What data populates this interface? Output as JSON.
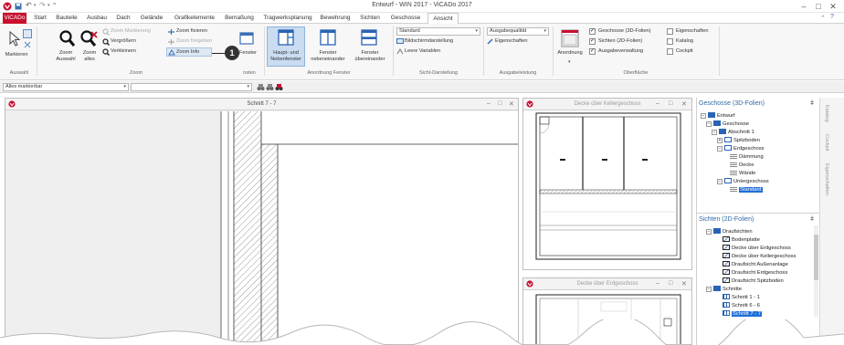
{
  "window": {
    "title": "Entwurf - WIN 2017 - ViCADo 2017"
  },
  "tabs": [
    {
      "label": "ViCADo"
    },
    {
      "label": "Start"
    },
    {
      "label": "Bauteile"
    },
    {
      "label": "Ausbau"
    },
    {
      "label": "Dach"
    },
    {
      "label": "Gelände"
    },
    {
      "label": "Grafikelemente"
    },
    {
      "label": "Bemaßung"
    },
    {
      "label": "Tragwerksplanung"
    },
    {
      "label": "Bewehrung"
    },
    {
      "label": "Sichten"
    },
    {
      "label": "Geschosse"
    },
    {
      "label": "Ansicht"
    }
  ],
  "ribbon": {
    "auswahl": {
      "markieren": "Markieren",
      "group": "Auswahl"
    },
    "zoom": {
      "zoom_auswahl_1": "Zoom",
      "zoom_auswahl_2": "Auswahl",
      "zoom_alles_1": "Zoom",
      "zoom_alles_2": "alles",
      "zoom_markierung": "Zoom Markierung",
      "vergroessern": "Vergrößern",
      "verkleinern": "Verkleinern",
      "zoom_fixieren": "Zoom fixieren",
      "zoom_freigeben": "Zoom freigeben",
      "zoom_info": "Zoom Info",
      "group": "Zoom"
    },
    "callout": "1",
    "fenster": {
      "label_partial": "Fenster",
      "group_partial": "nsten"
    },
    "anordnung": {
      "haupt_1": "Haupt- und",
      "haupt_2": "Nebenfenster",
      "neben_1": "Fenster",
      "neben_2": "nebeneinander",
      "ueber_1": "Fenster",
      "ueber_2": "übereinander",
      "group": "Anordnung Fenster"
    },
    "sicht": {
      "standard": "Standard",
      "bildschirm": "Bildschirmdarstellung",
      "leere": "Leere Variablen",
      "group": "Sicht-Darstellung"
    },
    "ausgabe": {
      "quality": "Ausgabequalität",
      "eigenschaften": "Eigenschaften",
      "group": "Ausgabeleistung"
    },
    "oberflaeche": {
      "anordnung": "Anordnung",
      "geschosse_3d": "Geschosse (3D-Folien)",
      "sichten_2d": "Sichten (2D-Folien)",
      "ausgabe_verw": "Ausgabeverwaltung",
      "eigenschaften": "Eigenschaften",
      "katalog": "Katalog",
      "cockpit": "Cockpit",
      "group": "Oberfläche",
      "geschosse_checked": true,
      "sichten_checked": true,
      "ausgabe_checked": true
    }
  },
  "filter": {
    "value": "Alles markierbar"
  },
  "views": {
    "main": {
      "title": "Schnitt 7 - 7"
    },
    "top": {
      "title": "Decke über Kellergeschoss"
    },
    "bottom": {
      "title": "Decke über Erdgeschoss"
    }
  },
  "geschosse_panel": {
    "title": "Geschosse (3D-Folien)",
    "pin": "ǂ",
    "items": [
      {
        "label": "Entwurf"
      },
      {
        "label": "Geschosse"
      },
      {
        "label": "Abschnitt 1"
      },
      {
        "label": "Spitzboden"
      },
      {
        "label": "Erdgeschoss"
      },
      {
        "label": "Dämmung"
      },
      {
        "label": "Decke"
      },
      {
        "label": "Wände"
      },
      {
        "label": "Untergeschoss"
      },
      {
        "label": "Standard"
      }
    ]
  },
  "sichten_panel": {
    "title": "Sichten (2D-Folien)",
    "pin": "ǂ",
    "items": [
      {
        "label": "Draufsichten"
      },
      {
        "label": "Bodenplatte"
      },
      {
        "label": "Decke über Erdgeschoss"
      },
      {
        "label": "Decke über Kellergeschoss"
      },
      {
        "label": "Draufsicht Außenanlage"
      },
      {
        "label": "Draufsicht Erdgeschoss"
      },
      {
        "label": "Draufsicht Spitzboden"
      },
      {
        "label": "Schnitte"
      },
      {
        "label": "Schnitt 1 - 1"
      },
      {
        "label": "Schnitt 6 - 6"
      },
      {
        "label": "Schnitt 7 - 7"
      }
    ]
  },
  "side_tabs": [
    {
      "label": "Katalog"
    },
    {
      "label": "Cockpit"
    },
    {
      "label": "Eigenschaften"
    }
  ],
  "colors": {
    "accent": "#c8102e",
    "selection": "#1e6fd9",
    "panel_title": "#2f6aa5"
  }
}
